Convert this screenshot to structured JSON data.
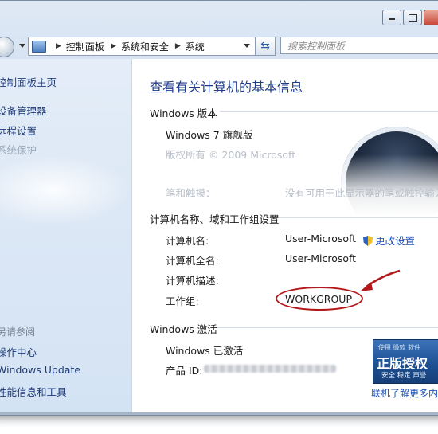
{
  "address_bar": {
    "crumbs": [
      "控制面板",
      "系统和安全",
      "系统"
    ],
    "search_placeholder": "搜索控制面板"
  },
  "sidebar": {
    "home_link": "控制面板主页",
    "links": [
      "设备管理器",
      "远程设置",
      "系统保护"
    ],
    "see_also_title": "另请参阅",
    "see_also_links": [
      "操作中心",
      "Windows Update",
      "性能信息和工具"
    ]
  },
  "main": {
    "title": "查看有关计算机的基本信息",
    "edition": {
      "heading": "Windows 版本",
      "name": "Windows 7 旗舰版",
      "copyright": "版权所有 © 2009 Microsoft",
      "pen_label": "笔和触摸：",
      "pen_value": "没有可用于此显示器的笔或触控输入"
    },
    "computer": {
      "heading": "计算机名称、域和工作组设置",
      "rows": [
        {
          "label": "计算机名:",
          "value": "User-Microsoft"
        },
        {
          "label": "计算机全名:",
          "value": "User-Microsoft"
        },
        {
          "label": "计算机描述:",
          "value": ""
        },
        {
          "label": "工作组:",
          "value": "WORKGROUP"
        }
      ],
      "change_settings": "更改设置"
    },
    "activation": {
      "heading": "Windows 激活",
      "status": "Windows 已激活",
      "product_id_label": "产品 ID:",
      "badge_line1": "使用 微软 软件",
      "badge_line2": "正版授权",
      "badge_line3": "安全 稳定 声誉",
      "learn_more": "联机了解更多内"
    }
  },
  "colors": {
    "accent_title": "#1e3a8a",
    "link": "#1c4fb8",
    "annotation": "#b21a1a"
  }
}
